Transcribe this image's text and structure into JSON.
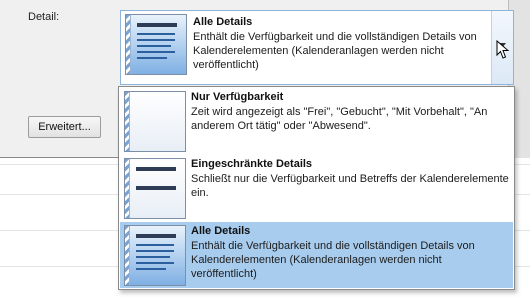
{
  "dialog": {
    "detail_label": "Detail:",
    "advanced_button": "Erweitert..."
  },
  "combo": {
    "selected_title": "Alle Details",
    "selected_desc": "Enthält die Verfügbarkeit und die vollständigen Details von Kalenderelementen (Kalenderanlagen werden nicht veröffentlicht)"
  },
  "dropdown": {
    "items": [
      {
        "title": "Nur Verfügbarkeit",
        "desc": "Zeit wird angezeigt als \"Frei\", \"Gebucht\", \"Mit Vorbehalt\", \"An anderem Ort tätig\" oder \"Abwesend\".",
        "icon": "availability-only-icon",
        "selected": false
      },
      {
        "title": "Eingeschränkte Details",
        "desc": "Schließt nur die Verfügbarkeit und Betreffs der Kalenderelemente ein.",
        "icon": "limited-details-icon",
        "selected": false
      },
      {
        "title": "Alle Details",
        "desc": "Enthält die Verfügbarkeit und die vollständigen Details von Kalenderelementen (Kalenderanlagen werden nicht veröffentlicht)",
        "icon": "full-details-icon",
        "selected": true
      }
    ]
  },
  "colors": {
    "selection": "#a8ccee",
    "combo_border": "#8fb4dc",
    "dialog_bg": "#f0f0f0"
  }
}
